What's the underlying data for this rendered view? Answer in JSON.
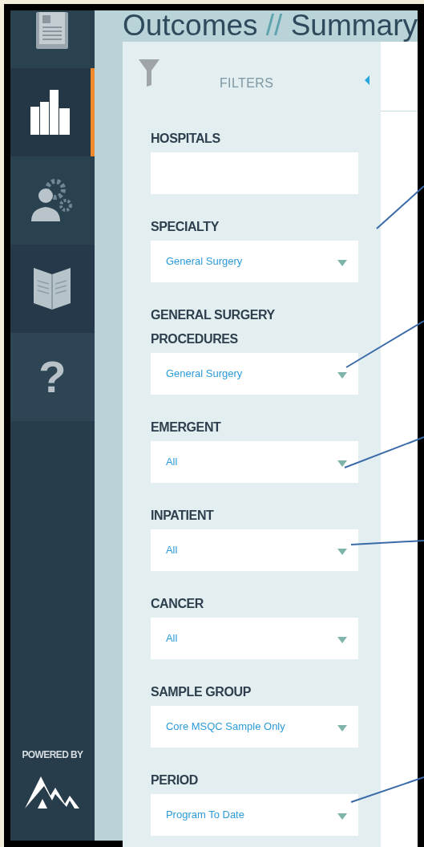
{
  "header": {
    "title_start": "Outcomes",
    "separator": "//",
    "title_end": "Summary"
  },
  "sidebar": {
    "items": [
      {
        "kind": "report",
        "selected": false
      },
      {
        "kind": "chart",
        "selected": true
      },
      {
        "kind": "users",
        "selected": false
      },
      {
        "kind": "book",
        "selected": false
      },
      {
        "kind": "help",
        "selected": false,
        "label": "?"
      }
    ],
    "powered_by": "POWERED BY"
  },
  "filters": {
    "title": "FILTERS",
    "fields": [
      {
        "label": "HOSPITALS"
      },
      {
        "label": "SPECIALTY",
        "value": "General Surgery"
      },
      {
        "label": "GENERAL SURGERY PROCEDURES",
        "value": "General Surgery"
      },
      {
        "label": "EMERGENT",
        "value": "All"
      },
      {
        "label": "INPATIENT",
        "value": "All"
      },
      {
        "label": "CANCER",
        "value": "All"
      },
      {
        "label": "SAMPLE GROUP",
        "value": "Core MSQC Sample Only"
      },
      {
        "label": "PERIOD",
        "value": "Program To Date"
      }
    ]
  }
}
